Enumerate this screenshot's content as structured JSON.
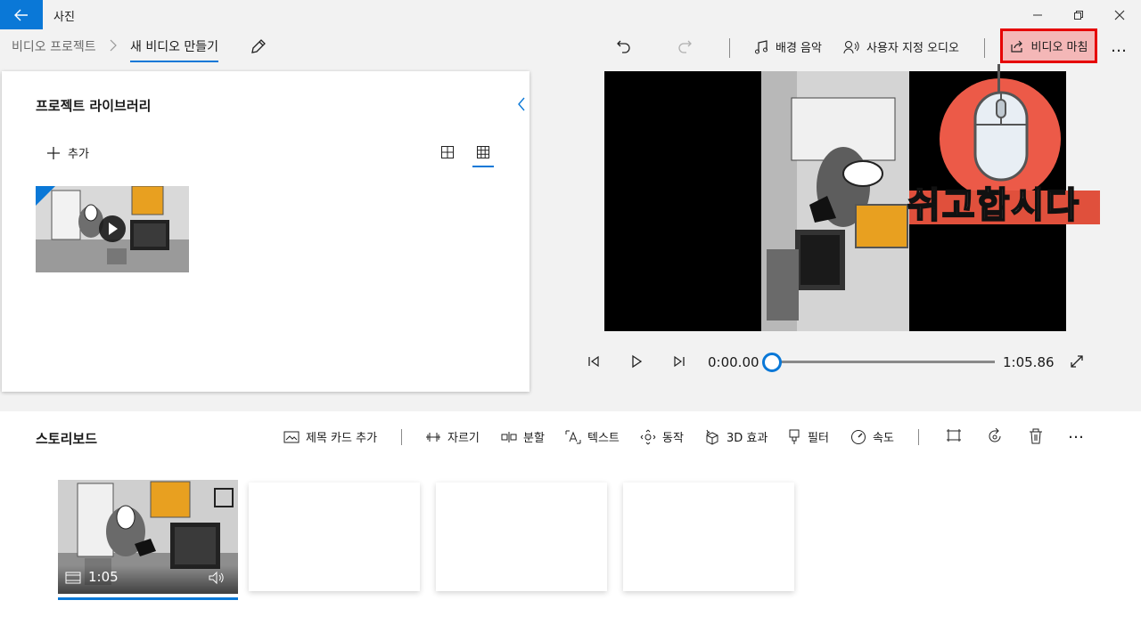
{
  "titlebar": {
    "app_title": "사진"
  },
  "header": {
    "breadcrumb_parent": "비디오 프로젝트",
    "breadcrumb_current": "새 비디오 만들기",
    "background_music": "배경 음악",
    "custom_audio": "사용자 지정 오디오",
    "finish_video": "비디오 마침",
    "more": "…"
  },
  "library": {
    "title": "프로젝트 라이브러리",
    "add_label": "추가"
  },
  "player": {
    "current_time": "0:00.00",
    "total_time": "1:05.86",
    "progress": 0
  },
  "overlay": {
    "caption": "쉬고합시다"
  },
  "storyboard": {
    "title": "스토리보드",
    "tools": {
      "title_card": "제목 카드 추가",
      "trim": "자르기",
      "split": "분할",
      "text": "텍스트",
      "motion": "동작",
      "effects_3d": "3D 효과",
      "filters": "필터",
      "speed": "속도"
    },
    "clips": [
      {
        "duration": "1:05"
      }
    ]
  },
  "colors": {
    "accent": "#0a78d7",
    "highlight_border": "#e60000",
    "overlay_red": "#ec5a48"
  }
}
